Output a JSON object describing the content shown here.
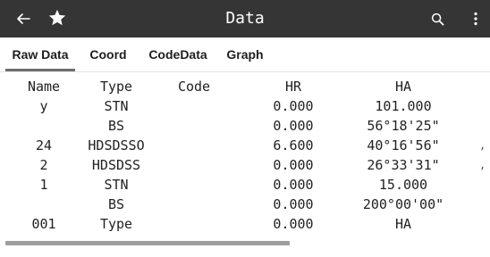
{
  "appbar": {
    "title": "Data",
    "icons": {
      "back": "arrow-left-icon",
      "favorite": "star-icon",
      "search": "search-icon",
      "more": "more-vert-icon"
    }
  },
  "tabs": [
    {
      "label": "Raw Data",
      "active": true
    },
    {
      "label": "Coord",
      "active": false
    },
    {
      "label": "CodeData",
      "active": false
    },
    {
      "label": "Graph",
      "active": false
    }
  ],
  "table": {
    "headers": {
      "name": "Name",
      "type": "Type",
      "code": "Code",
      "hr": "HR",
      "ha": "HA"
    },
    "rows": [
      {
        "name": "y",
        "type": "STN",
        "code": "",
        "hr": "0.000",
        "ha": "101.000",
        "tail": ""
      },
      {
        "name": "",
        "type": "BS",
        "code": "",
        "hr": "0.000",
        "ha": "56°18'25\"",
        "tail": ""
      },
      {
        "name": "24",
        "type": "HDSDSSO",
        "code": "",
        "hr": "6.600",
        "ha": "40°16'56\"",
        "tail": ","
      },
      {
        "name": "2",
        "type": "HDSDSS",
        "code": "",
        "hr": "0.000",
        "ha": "26°33'31\"",
        "tail": ","
      },
      {
        "name": "1",
        "type": "STN",
        "code": "",
        "hr": "0.000",
        "ha": "15.000",
        "tail": ""
      },
      {
        "name": "",
        "type": "BS",
        "code": "",
        "hr": "0.000",
        "ha": "200°00'00\"",
        "tail": ""
      },
      {
        "name": "001",
        "type": "Type",
        "code": "",
        "hr": "0.000",
        "ha": "HA",
        "tail": ""
      }
    ]
  },
  "colors": {
    "appbar": "#353535",
    "tab_indicator": "#6f6f6f",
    "scrollbar": "#9d9d9d"
  }
}
